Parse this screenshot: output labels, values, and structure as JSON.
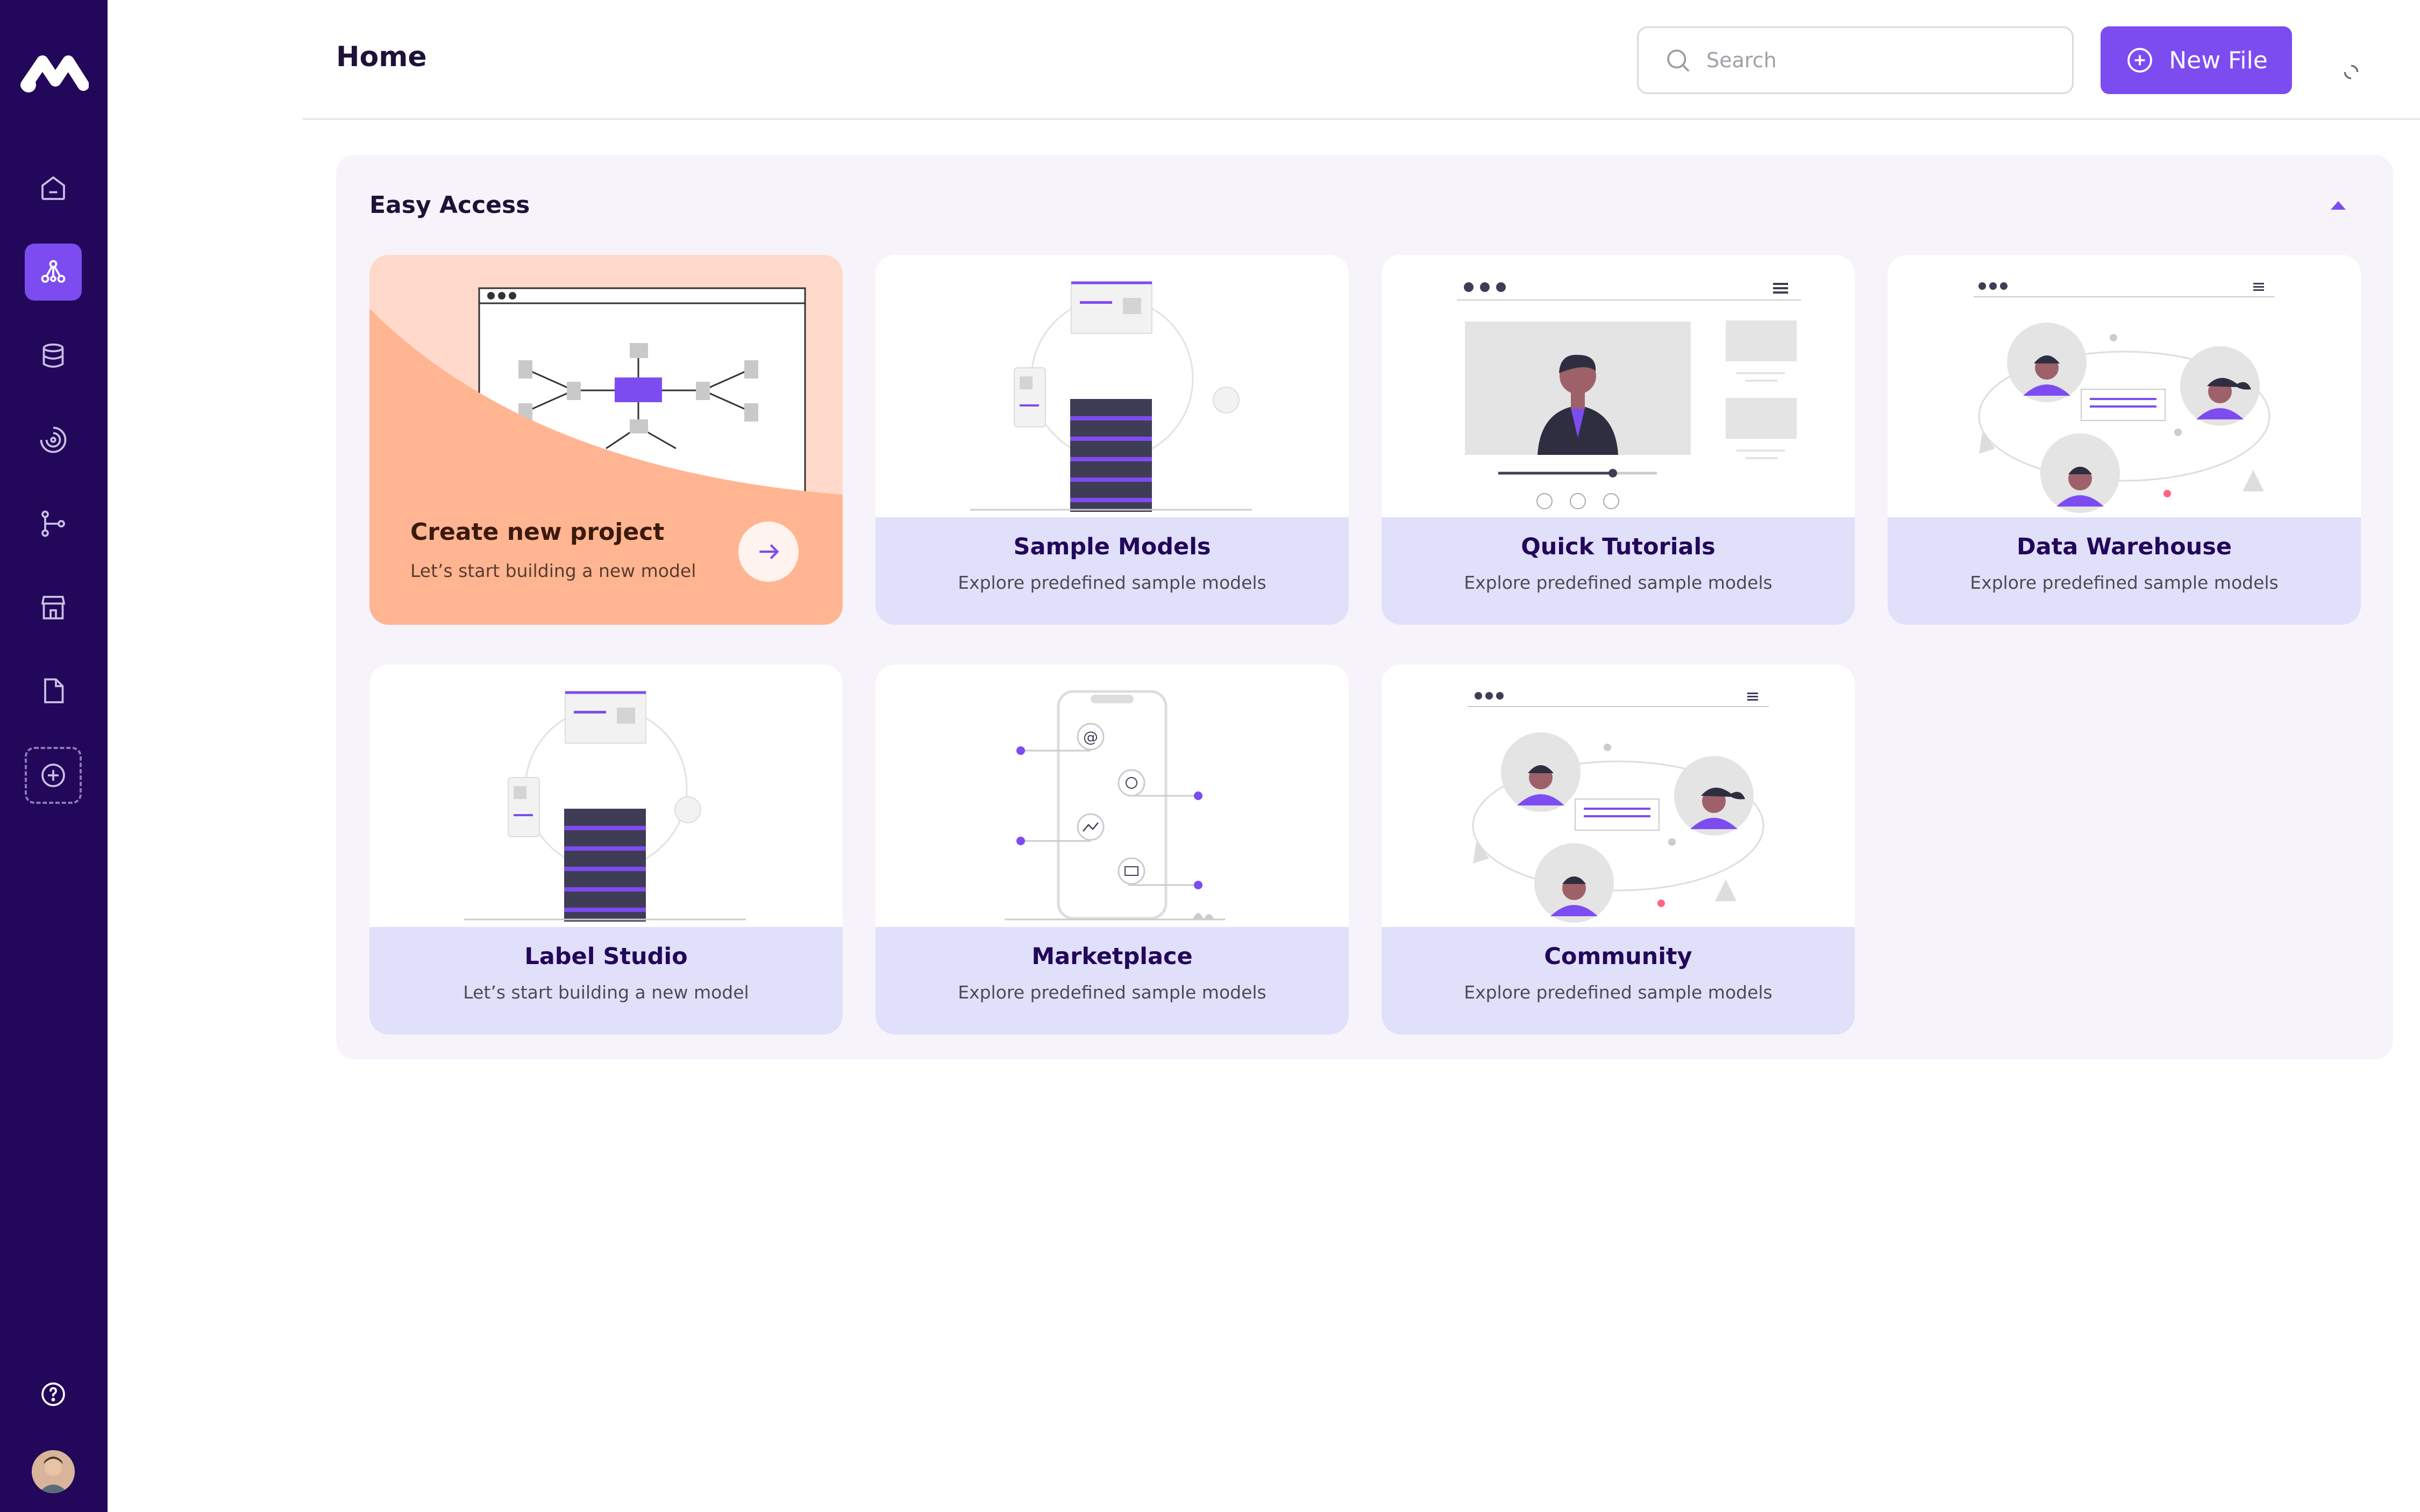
{
  "header": {
    "title": "Home",
    "search_placeholder": "Search",
    "new_file_label": "New File"
  },
  "sidebar": {
    "items": [
      {
        "name": "home",
        "icon": "home-icon",
        "active": false
      },
      {
        "name": "models",
        "icon": "network-icon",
        "active": true
      },
      {
        "name": "data",
        "icon": "database-icon",
        "active": false
      },
      {
        "name": "training",
        "icon": "spinner-icon",
        "active": false
      },
      {
        "name": "pipelines",
        "icon": "flow-icon",
        "active": false
      },
      {
        "name": "marketplace",
        "icon": "store-icon",
        "active": false
      },
      {
        "name": "files",
        "icon": "file-icon",
        "active": false
      },
      {
        "name": "add",
        "icon": "plus-circle-icon",
        "active": false
      }
    ],
    "help_icon": "help-circle-icon"
  },
  "easy_access": {
    "title": "Easy Access",
    "cards": [
      {
        "title": "Create new project",
        "subtitle": "Let’s start building a new model"
      },
      {
        "title": "Sample Models",
        "subtitle": "Explore predefined sample models"
      },
      {
        "title": "Quick Tutorials",
        "subtitle": "Explore predefined sample models"
      },
      {
        "title": "Data Warehouse",
        "subtitle": "Explore predefined sample models"
      },
      {
        "title": "Label Studio",
        "subtitle": "Let’s start building a new model"
      },
      {
        "title": "Marketplace",
        "subtitle": "Explore predefined sample models"
      },
      {
        "title": "Community",
        "subtitle": "Explore predefined sample models"
      }
    ]
  },
  "colors": {
    "sidebar_bg": "#23075a",
    "accent": "#7d4cf0",
    "card_footer": "#e0e0fb",
    "create_card": "#ffb591",
    "panel_bg": "#f7f3fa"
  }
}
